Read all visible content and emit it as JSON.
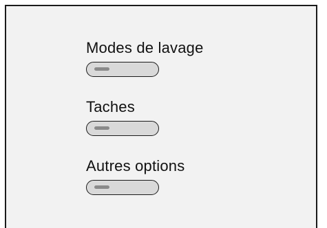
{
  "menu": {
    "items": [
      {
        "label": "Modes de lavage"
      },
      {
        "label": "Taches"
      },
      {
        "label": "Autres options"
      }
    ]
  },
  "colors": {
    "panel_background": "#f2f2f2",
    "border": "#1a1a1a",
    "control_fill": "#d9d9d9",
    "indicator": "#8a8a8a"
  }
}
